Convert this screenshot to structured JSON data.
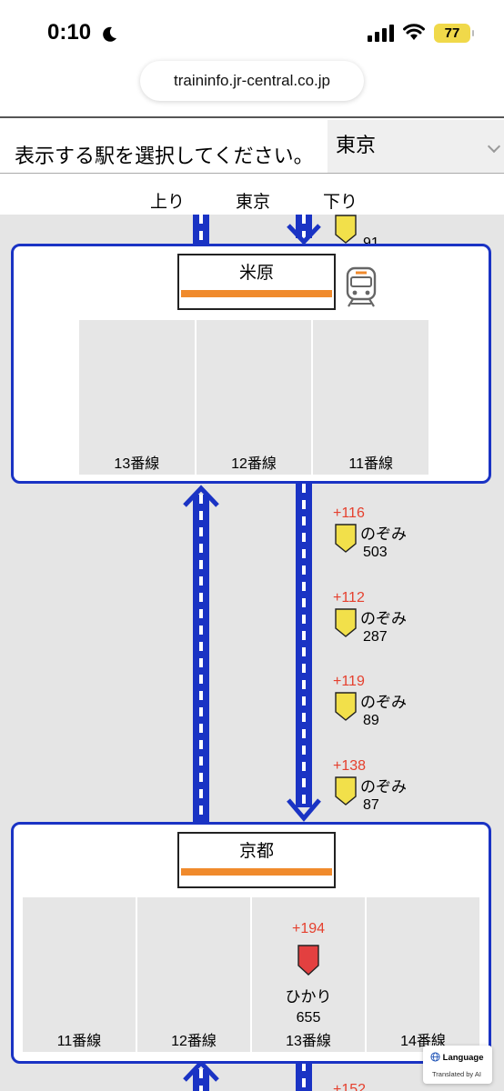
{
  "status_bar": {
    "time": "0:10",
    "battery": "77"
  },
  "browser": {
    "url": "traininfo.jr-central.co.jp"
  },
  "selector": {
    "prompt": "表示する駅を選択してください。",
    "selected_station": "東京"
  },
  "direction_header": {
    "up": "上り",
    "center": "東京",
    "down": "下り"
  },
  "top_partial_train": {
    "number": "91"
  },
  "stations": [
    {
      "name": "米原",
      "platforms": [
        {
          "label": "13番線"
        },
        {
          "label": "12番線"
        },
        {
          "label": "11番線"
        }
      ]
    },
    {
      "name": "京都",
      "platforms": [
        {
          "label": "11番線"
        },
        {
          "label": "12番線"
        },
        {
          "label": "13番線",
          "train": {
            "delay": "+194",
            "name": "ひかり",
            "number": "655"
          }
        },
        {
          "label": "14番線"
        }
      ]
    }
  ],
  "trains_between": [
    {
      "delay": "+116",
      "name": "のぞみ",
      "number": "503"
    },
    {
      "delay": "+112",
      "name": "のぞみ",
      "number": "287"
    },
    {
      "delay": "+119",
      "name": "のぞみ",
      "number": "89"
    },
    {
      "delay": "+138",
      "name": "のぞみ",
      "number": "87"
    }
  ],
  "bottom_partial_delay": "+152",
  "translate_widget": {
    "label": "Language",
    "note": "Translated by AI"
  },
  "colors": {
    "track": "#1a33c4",
    "nozomi_flag": "#f2e04a",
    "hikari_flag": "#e34040",
    "delay_text": "#e5402e",
    "name_stripe": "#f08a2c"
  }
}
